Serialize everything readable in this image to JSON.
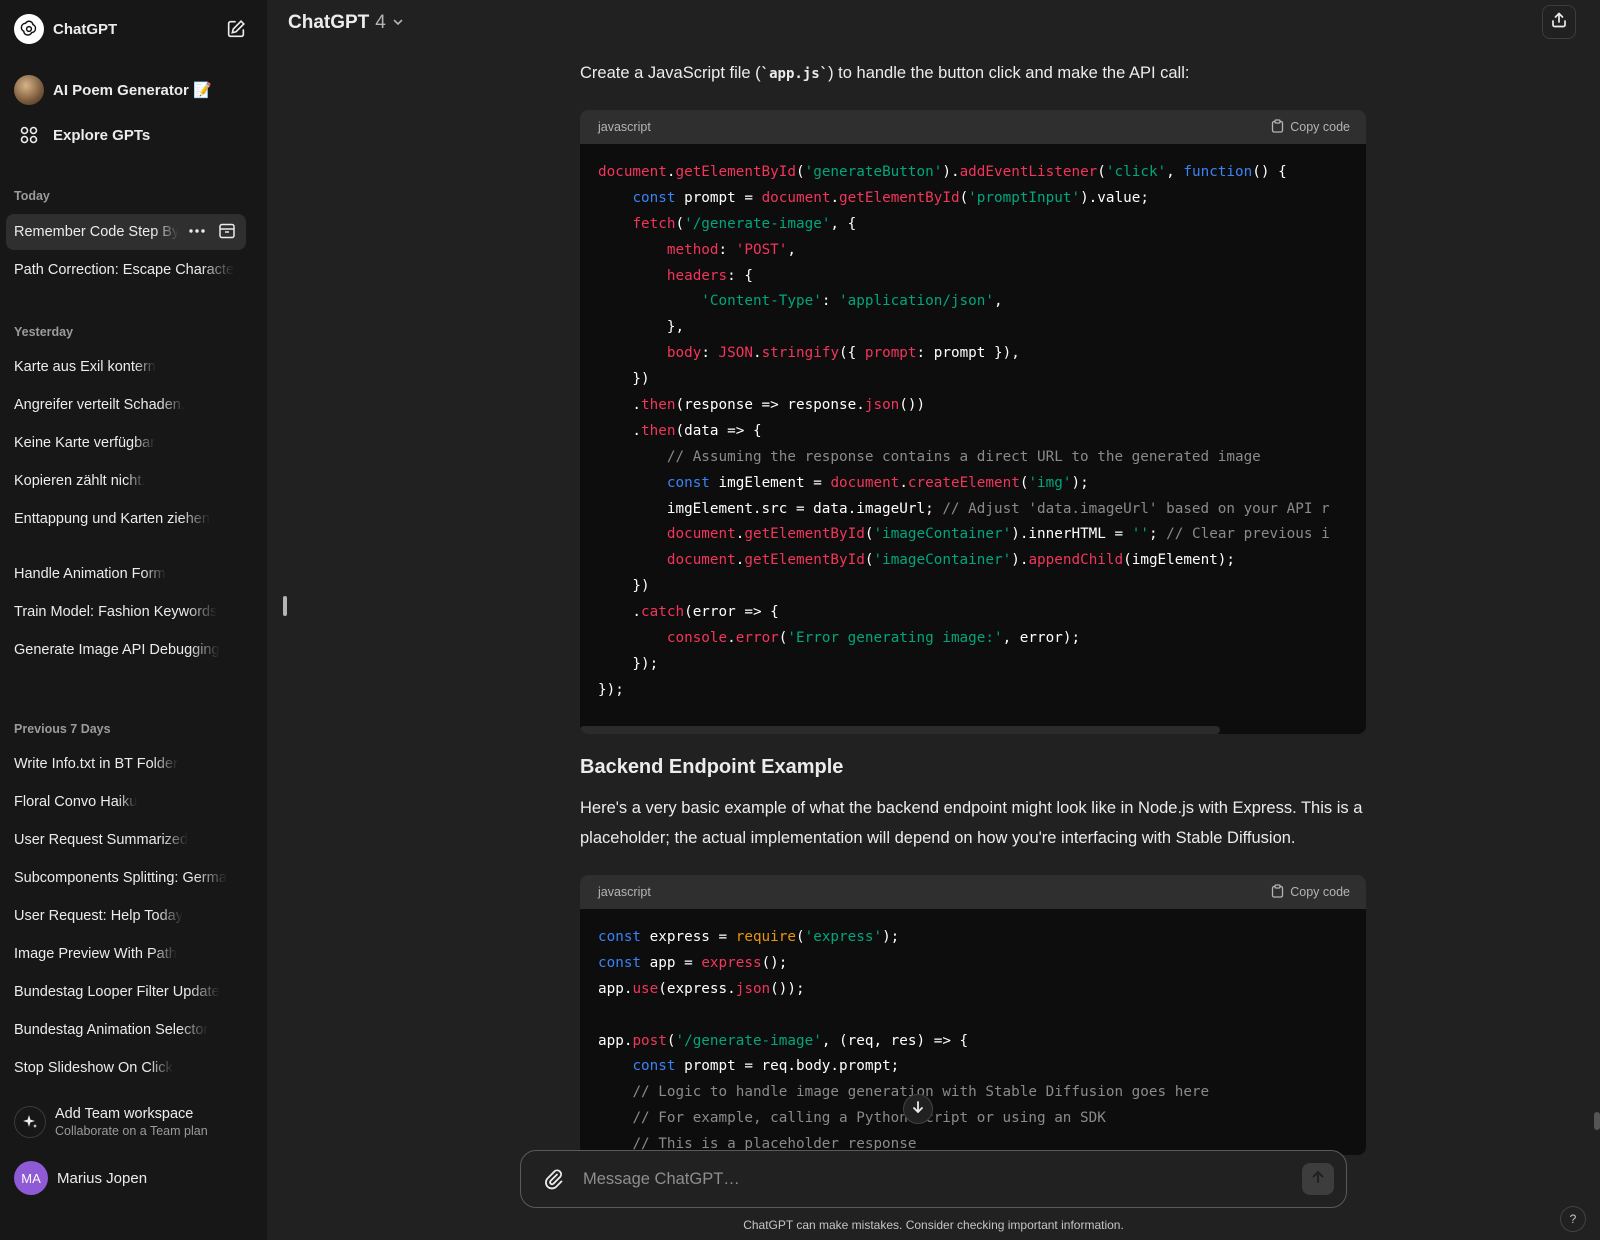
{
  "sidebar": {
    "brand": "ChatGPT",
    "gpt_item": "AI Poem Generator 📝",
    "explore": "Explore GPTs",
    "sections": [
      {
        "title": "Today",
        "items": [
          "Remember Code Step By",
          "Path Correction: Escape Characte"
        ]
      },
      {
        "title": "Yesterday",
        "items": [
          "Karte aus Exil kontern",
          "Angreifer verteilt Schaden.",
          "Keine Karte verfügbar",
          "Kopieren zählt nicht.",
          "Enttappung und Karten ziehen",
          "Handle Animation Form",
          "Train Model: Fashion Keywords",
          "Generate Image API Debugging"
        ]
      },
      {
        "title": "Previous 7 Days",
        "items": [
          "Write Info.txt in BT Folder",
          "Floral Convo Haiku",
          "User Request Summarized",
          "Subcomponents Splitting: Germa",
          "User Request: Help Today",
          "Image Preview With Path",
          "Bundestag Looper Filter Update",
          "Bundestag Animation Selector",
          "Stop Slideshow On Click"
        ]
      }
    ],
    "team": {
      "title": "Add Team workspace",
      "subtitle": "Collaborate on a Team plan"
    },
    "user": {
      "initials": "MA",
      "name": "Marius Jopen"
    }
  },
  "header": {
    "model": "ChatGPT",
    "version": "4"
  },
  "conversation": {
    "intro_pre": "Create a JavaScript file (",
    "intro_code": "`app.js`",
    "intro_post": ") to handle the button click and make the API call:",
    "code1": {
      "lang": "javascript",
      "copy_label": "Copy code",
      "lines": [
        [
          [
            "document",
            "r"
          ],
          [
            ".",
            "w"
          ],
          [
            "getElementById",
            "r"
          ],
          [
            "(",
            "w"
          ],
          [
            "'generateButton'",
            "g"
          ],
          [
            ").",
            "w"
          ],
          [
            "addEventListener",
            "r"
          ],
          [
            "(",
            "w"
          ],
          [
            "'click'",
            "g"
          ],
          [
            ", ",
            "w"
          ],
          [
            "function",
            "b"
          ],
          [
            "() {",
            "w"
          ]
        ],
        [
          [
            "    ",
            "w"
          ],
          [
            "const",
            "b"
          ],
          [
            " prompt = ",
            "w"
          ],
          [
            "document",
            "r"
          ],
          [
            ".",
            "w"
          ],
          [
            "getElementById",
            "r"
          ],
          [
            "(",
            "w"
          ],
          [
            "'promptInput'",
            "g"
          ],
          [
            ").value;",
            "w"
          ]
        ],
        [
          [
            "    ",
            "w"
          ],
          [
            "fetch",
            "r"
          ],
          [
            "(",
            "w"
          ],
          [
            "'/generate-image'",
            "g"
          ],
          [
            ", {",
            "w"
          ]
        ],
        [
          [
            "        ",
            "w"
          ],
          [
            "method",
            "r"
          ],
          [
            ": ",
            "w"
          ],
          [
            "'POST'",
            "r"
          ],
          [
            ",",
            "w"
          ]
        ],
        [
          [
            "        ",
            "w"
          ],
          [
            "headers",
            "r"
          ],
          [
            ": {",
            "w"
          ]
        ],
        [
          [
            "            ",
            "w"
          ],
          [
            "'Content-Type'",
            "g"
          ],
          [
            ": ",
            "w"
          ],
          [
            "'application/json'",
            "g"
          ],
          [
            ",",
            "w"
          ]
        ],
        [
          [
            "        },",
            "w"
          ]
        ],
        [
          [
            "        ",
            "w"
          ],
          [
            "body",
            "r"
          ],
          [
            ": ",
            "w"
          ],
          [
            "JSON",
            "r"
          ],
          [
            ".",
            "w"
          ],
          [
            "stringify",
            "r"
          ],
          [
            "({ ",
            "w"
          ],
          [
            "prompt",
            "r"
          ],
          [
            ": prompt }),",
            "w"
          ]
        ],
        [
          [
            "    })",
            "w"
          ]
        ],
        [
          [
            "    .",
            "w"
          ],
          [
            "then",
            "r"
          ],
          [
            "(response => response.",
            "w"
          ],
          [
            "json",
            "r"
          ],
          [
            "())",
            "w"
          ]
        ],
        [
          [
            "    .",
            "w"
          ],
          [
            "then",
            "r"
          ],
          [
            "(data => {",
            "w"
          ]
        ],
        [
          [
            "        ",
            "w"
          ],
          [
            "// Assuming the response contains a direct URL to the generated image",
            "c"
          ]
        ],
        [
          [
            "        ",
            "w"
          ],
          [
            "const",
            "b"
          ],
          [
            " imgElement = ",
            "w"
          ],
          [
            "document",
            "r"
          ],
          [
            ".",
            "w"
          ],
          [
            "createElement",
            "r"
          ],
          [
            "(",
            "w"
          ],
          [
            "'img'",
            "g"
          ],
          [
            ");",
            "w"
          ]
        ],
        [
          [
            "        imgElement.src = data.imageUrl; ",
            "w"
          ],
          [
            "// Adjust 'data.imageUrl' based on your API r",
            "c"
          ]
        ],
        [
          [
            "        ",
            "w"
          ],
          [
            "document",
            "r"
          ],
          [
            ".",
            "w"
          ],
          [
            "getElementById",
            "r"
          ],
          [
            "(",
            "w"
          ],
          [
            "'imageContainer'",
            "g"
          ],
          [
            ").innerHTML = ",
            "w"
          ],
          [
            "''",
            "g"
          ],
          [
            "; ",
            "w"
          ],
          [
            "// Clear previous i",
            "c"
          ]
        ],
        [
          [
            "        ",
            "w"
          ],
          [
            "document",
            "r"
          ],
          [
            ".",
            "w"
          ],
          [
            "getElementById",
            "r"
          ],
          [
            "(",
            "w"
          ],
          [
            "'imageContainer'",
            "g"
          ],
          [
            ").",
            "w"
          ],
          [
            "appendChild",
            "r"
          ],
          [
            "(imgElement);",
            "w"
          ]
        ],
        [
          [
            "    })",
            "w"
          ]
        ],
        [
          [
            "    .",
            "w"
          ],
          [
            "catch",
            "r"
          ],
          [
            "(error => {",
            "w"
          ]
        ],
        [
          [
            "        ",
            "w"
          ],
          [
            "console",
            "r"
          ],
          [
            ".",
            "w"
          ],
          [
            "error",
            "r"
          ],
          [
            "(",
            "w"
          ],
          [
            "'Error generating image:'",
            "g"
          ],
          [
            ", error);",
            "w"
          ]
        ],
        [
          [
            "    });",
            "w"
          ]
        ],
        [
          [
            "});",
            "w"
          ]
        ]
      ]
    },
    "heading": "Backend Endpoint Example",
    "paragraph": "Here's a very basic example of what the backend endpoint might look like in Node.js with Express. This is a placeholder; the actual implementation will depend on how you're interfacing with Stable Diffusion.",
    "code2": {
      "lang": "javascript",
      "copy_label": "Copy code",
      "lines": [
        [
          [
            "const",
            "b"
          ],
          [
            " express = ",
            "w"
          ],
          [
            "require",
            "o"
          ],
          [
            "(",
            "w"
          ],
          [
            "'express'",
            "g"
          ],
          [
            ");",
            "w"
          ]
        ],
        [
          [
            "const",
            "b"
          ],
          [
            " app = ",
            "w"
          ],
          [
            "express",
            "r"
          ],
          [
            "();",
            "w"
          ]
        ],
        [
          [
            "app.",
            "w"
          ],
          [
            "use",
            "r"
          ],
          [
            "(express.",
            "w"
          ],
          [
            "json",
            "r"
          ],
          [
            "());",
            "w"
          ]
        ],
        [
          [
            "",
            "w"
          ]
        ],
        [
          [
            "app.",
            "w"
          ],
          [
            "post",
            "r"
          ],
          [
            "(",
            "w"
          ],
          [
            "'/generate-image'",
            "g"
          ],
          [
            ", (req, res) => {",
            "w"
          ]
        ],
        [
          [
            "    ",
            "w"
          ],
          [
            "const",
            "b"
          ],
          [
            " prompt = req.body.prompt;",
            "w"
          ]
        ],
        [
          [
            "    ",
            "w"
          ],
          [
            "// Logic to handle image generation with Stable Diffusion goes here",
            "c"
          ]
        ],
        [
          [
            "    ",
            "w"
          ],
          [
            "// For example, calling a Python script or using an SDK",
            "c"
          ]
        ],
        [
          [
            "    ",
            "w"
          ],
          [
            "// This is a placeholder response",
            "c"
          ]
        ]
      ]
    }
  },
  "composer": {
    "placeholder": "Message ChatGPT…"
  },
  "disclaimer": "ChatGPT can make mistakes. Consider checking important information.",
  "help": "?",
  "colors": {
    "sidebar": "#171717",
    "main": "#212121",
    "code_bg": "#0d0d0d",
    "keyword": "#3b82f6",
    "ident": "#f2355b",
    "string": "#00a67d",
    "comment": "#8a8a8a"
  }
}
